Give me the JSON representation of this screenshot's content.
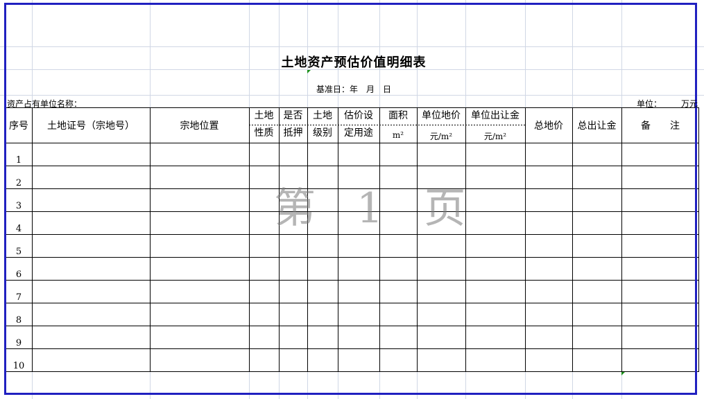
{
  "title": "土地资产预估价值明细表",
  "base_date": "基准日：年　月　日",
  "owner_label": "资产占有单位名称：",
  "unit_label": "单位：",
  "unit_value": "万元",
  "headers": {
    "seq": "序号",
    "cert": "土地证号（宗地号）",
    "location": "宗地位置",
    "nature_1": "土地",
    "nature_2": "性质",
    "mortgage_1": "是否",
    "mortgage_2": "抵押",
    "grade_1": "土地",
    "grade_2": "级别",
    "usage_1": "估价设",
    "usage_2": "定用途",
    "area_1": "面积",
    "area_2": "m²",
    "unit_price_1": "单位地价",
    "unit_price_2": "元/m²",
    "unit_fee_1": "单位出让金",
    "unit_fee_2": "元/m²",
    "total_price": "总地价",
    "total_fee": "总出让金",
    "remark": "备　　注"
  },
  "rows": [
    "1",
    "2",
    "3",
    "4",
    "5",
    "6",
    "7",
    "8",
    "9",
    "10"
  ],
  "watermark": "第 1 页"
}
